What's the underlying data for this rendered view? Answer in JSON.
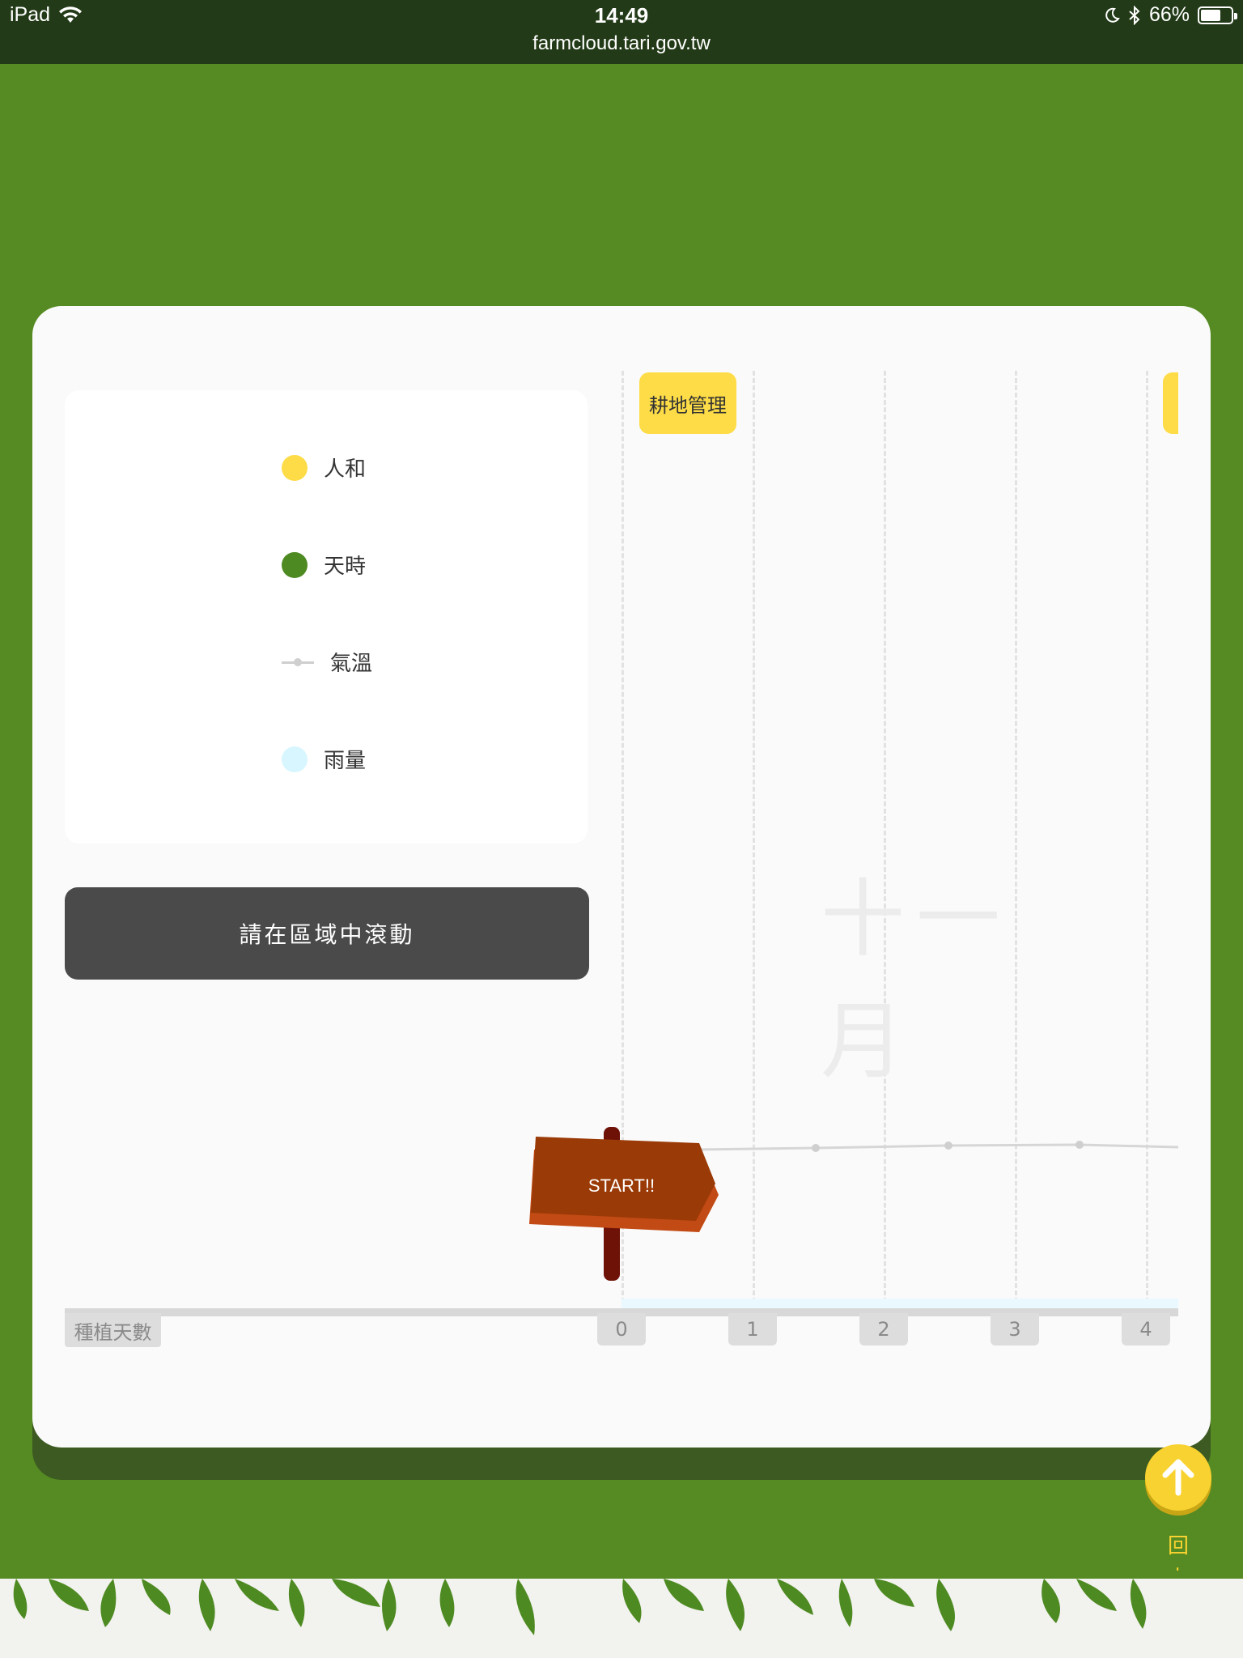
{
  "status_bar": {
    "device": "iPad",
    "time": "14:49",
    "url": "farmcloud.tari.gov.tw",
    "battery": "66%",
    "battery_level": 0.66
  },
  "legend": {
    "items": [
      {
        "label": "人和",
        "color": "#fddc47"
      },
      {
        "label": "天時",
        "color": "#4e8a22"
      },
      {
        "label": "氣溫",
        "color": "#cfcfcf"
      },
      {
        "label": "雨量",
        "color": "#d8f6ff"
      }
    ]
  },
  "scroll_hint": "請在區域中滾動",
  "timeline": {
    "axis_label": "種植天數",
    "days": [
      "0",
      "1",
      "2",
      "3",
      "4"
    ],
    "task_label": "耕地管理",
    "month_label": "十一月",
    "start_sign": "START!!"
  },
  "back_to_top": {
    "label": "回上面"
  },
  "colors": {
    "background": "#558b22",
    "card": "#fafafa",
    "accent_yellow": "#fddc47",
    "sign": "#9a3a07"
  }
}
